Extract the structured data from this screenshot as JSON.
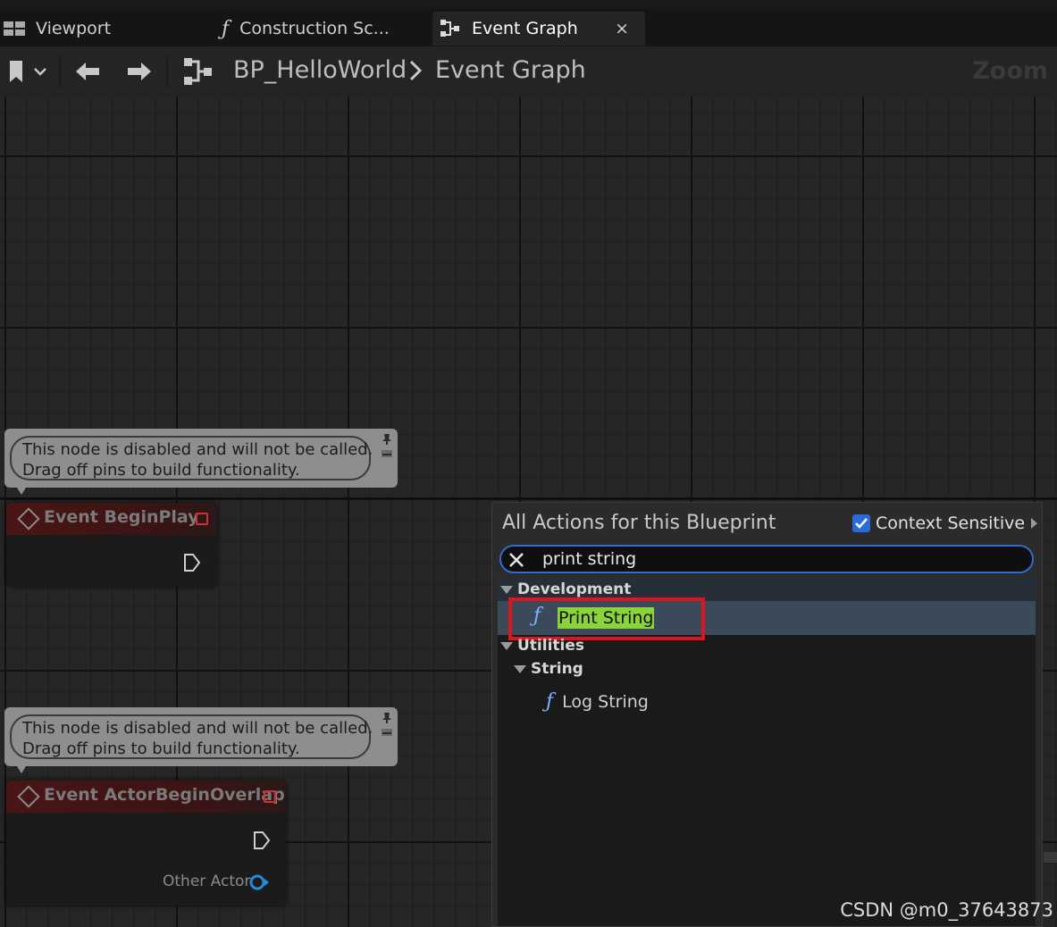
{
  "tabs": [
    {
      "label": "Viewport",
      "icon": "viewport-grid-icon"
    },
    {
      "label": "Construction Sc...",
      "icon": "function-icon"
    },
    {
      "label": "Event Graph",
      "icon": "event-graph-icon",
      "close": "×"
    }
  ],
  "toolbar": {
    "breadcrumb_blueprint": "BP_HelloWorld",
    "breadcrumb_graph": "Event Graph",
    "zoom_label": "Zoom"
  },
  "comments": [
    {
      "line1": "This node is disabled and will not be called.",
      "line2": "Drag off pins to build functionality."
    },
    {
      "line1": "This node is disabled and will not be called.",
      "line2": "Drag off pins to build functionality."
    }
  ],
  "nodes": [
    {
      "title": "Event BeginPlay"
    },
    {
      "title": "Event ActorBeginOverlap",
      "pin_label": "Other Actor"
    }
  ],
  "action_menu": {
    "title": "All Actions for this Blueprint",
    "context_label": "Context Sensitive",
    "context_checked": true,
    "search_value": "print string",
    "categories": [
      {
        "name": "Development",
        "items": [
          {
            "label": "Print String"
          }
        ]
      },
      {
        "name": "Utilities",
        "children": [
          {
            "name": "String",
            "items": [
              {
                "label": "Log String"
              }
            ]
          }
        ]
      }
    ]
  },
  "watermark": "CSDN @m0_37643873",
  "colors": {
    "selection_row": "#3b4a5a",
    "search_highlight": "#8bd33a",
    "red_box": "#e0141e",
    "checkbox": "#2d6ad9",
    "event_header": "#4a1515"
  }
}
